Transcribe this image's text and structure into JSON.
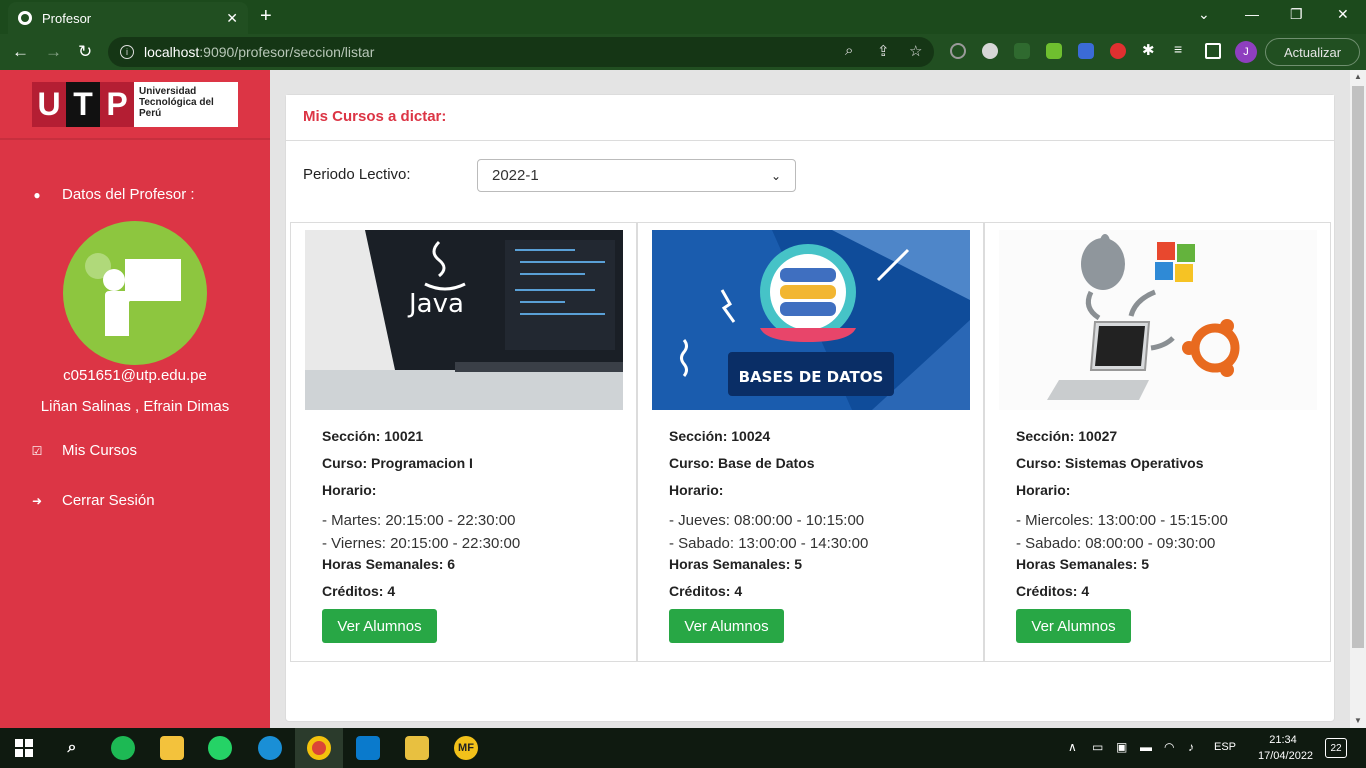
{
  "browser": {
    "tab_title": "Profesor",
    "tab_close": "✕",
    "new_tab": "+",
    "url_host": "localhost",
    "url_path": ":9090/profesor/seccion/listar",
    "update_label": "Actualizar",
    "profile_initial": "J"
  },
  "sidebar": {
    "logo": {
      "letters": [
        "U",
        "T",
        "P"
      ],
      "text": "Universidad Tecnológica del Perú"
    },
    "profile_heading": "Datos del Profesor :",
    "email": "c051651@utp.edu.pe",
    "name": "Liñan Salinas , Efrain Dimas",
    "nav": [
      {
        "label": "Mis Cursos",
        "icon": "check-square-icon"
      },
      {
        "label": "Cerrar Sesión",
        "icon": "sign-out-icon"
      }
    ]
  },
  "main": {
    "title": "Mis Cursos a dictar:",
    "period_label": "Periodo Lectivo:",
    "period_value": "2022-1",
    "courses": [
      {
        "image": "java-laptop-image",
        "image_text": "Java",
        "seccion": "Sección: 10021",
        "curso": "Curso: Programacion I",
        "horario": "Horario:",
        "schedule": [
          "- Martes: 20:15:00 - 22:30:00",
          "- Viernes: 20:15:00 - 22:30:00"
        ],
        "horas": "Horas Semanales: 6",
        "creditos": "Créditos: 4",
        "button": "Ver Alumnos"
      },
      {
        "image": "database-image",
        "image_text": "BASES DE DATOS",
        "seccion": "Sección: 10024",
        "curso": "Curso: Base de Datos",
        "horario": "Horario:",
        "schedule": [
          "- Jueves: 08:00:00 - 10:15:00",
          "- Sabado: 13:00:00 - 14:30:00"
        ],
        "horas": "Horas Semanales: 5",
        "creditos": "Créditos: 4",
        "button": "Ver Alumnos"
      },
      {
        "image": "operating-systems-image",
        "seccion": "Sección: 10027",
        "curso": "Curso: Sistemas Operativos",
        "horario": "Horario:",
        "schedule": [
          "- Miercoles: 13:00:00 - 15:15:00",
          "- Sabado: 08:00:00 - 09:30:00"
        ],
        "horas": "Horas Semanales: 5",
        "creditos": "Créditos: 4",
        "button": "Ver Alumnos"
      }
    ]
  },
  "taskbar": {
    "apps": [
      "windows-start",
      "search",
      "spotify",
      "file-explorer",
      "whatsapp",
      "edge",
      "chrome",
      "vscode",
      "app",
      "mf"
    ],
    "mf_label": "MF",
    "language": "ESP",
    "time": "21:34",
    "date": "17/04/2022",
    "notifications": "22"
  },
  "colors": {
    "sidebar": "#dc3545",
    "accent": "#dc3545",
    "button": "#28a745",
    "browser": "#214f21"
  }
}
